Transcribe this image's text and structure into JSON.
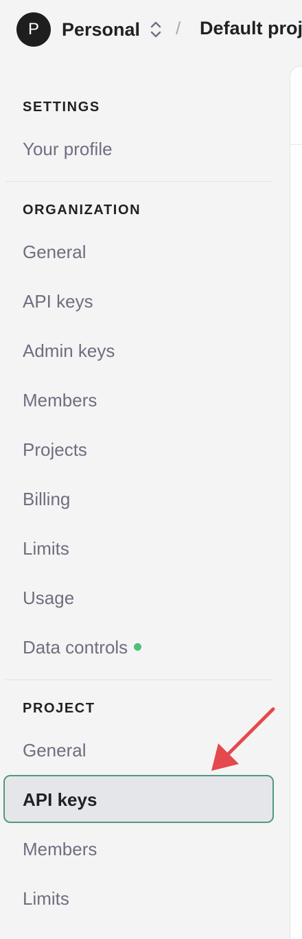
{
  "header": {
    "avatar_initial": "P",
    "org_name": "Personal",
    "separator": "/",
    "project_name": "Default proj"
  },
  "sidebar": {
    "sections": [
      {
        "heading": "SETTINGS",
        "items": [
          {
            "label": "Your profile"
          }
        ]
      },
      {
        "heading": "ORGANIZATION",
        "items": [
          {
            "label": "General"
          },
          {
            "label": "API keys"
          },
          {
            "label": "Admin keys"
          },
          {
            "label": "Members"
          },
          {
            "label": "Projects"
          },
          {
            "label": "Billing"
          },
          {
            "label": "Limits"
          },
          {
            "label": "Usage"
          },
          {
            "label": "Data controls",
            "status": "new"
          }
        ]
      },
      {
        "heading": "PROJECT",
        "items": [
          {
            "label": "General"
          },
          {
            "label": "API keys",
            "active": true
          },
          {
            "label": "Members"
          },
          {
            "label": "Limits"
          }
        ]
      }
    ]
  },
  "colors": {
    "accent_border": "#4e9a7c",
    "status_dot": "#4cc17a",
    "annotation_arrow": "#e5484d"
  },
  "icons": {
    "org_switcher": "chevron-up-down-icon",
    "annotation": "red-arrow-icon"
  }
}
